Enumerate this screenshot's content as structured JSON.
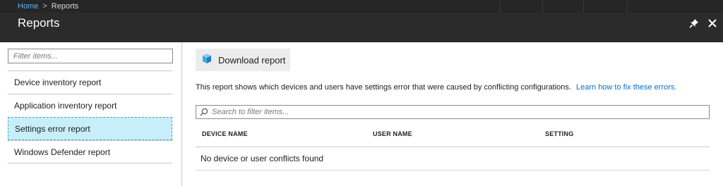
{
  "breadcrumb": {
    "home": "Home",
    "separator": ">",
    "current": "Reports"
  },
  "blade": {
    "title": "Reports",
    "icons": [
      "pin-icon",
      "close-icon"
    ]
  },
  "sidebar": {
    "filter_placeholder": "Filter items...",
    "items": [
      {
        "label": "Device inventory report",
        "selected": false
      },
      {
        "label": "Application inventory report",
        "selected": false
      },
      {
        "label": "Settings error report",
        "selected": true
      },
      {
        "label": "Windows Defender report",
        "selected": false
      }
    ]
  },
  "toolbar": {
    "download_label": "Download report",
    "download_icon": "cube-icon"
  },
  "content": {
    "description": "This report shows which devices and users have settings error that were caused by conflicting configurations.",
    "learn_link": "Learn how to fix these errors.",
    "search_placeholder": "Search to filter items..."
  },
  "table": {
    "columns": [
      "DEVICE NAME",
      "USER NAME",
      "SETTING"
    ],
    "empty_message": "No device or user conflicts found"
  },
  "colors": {
    "header_bg": "#2b2b2b",
    "link": "#0a6fc2",
    "breadcrumb_link": "#5db2ff",
    "selected_bg": "#c8eefa"
  }
}
